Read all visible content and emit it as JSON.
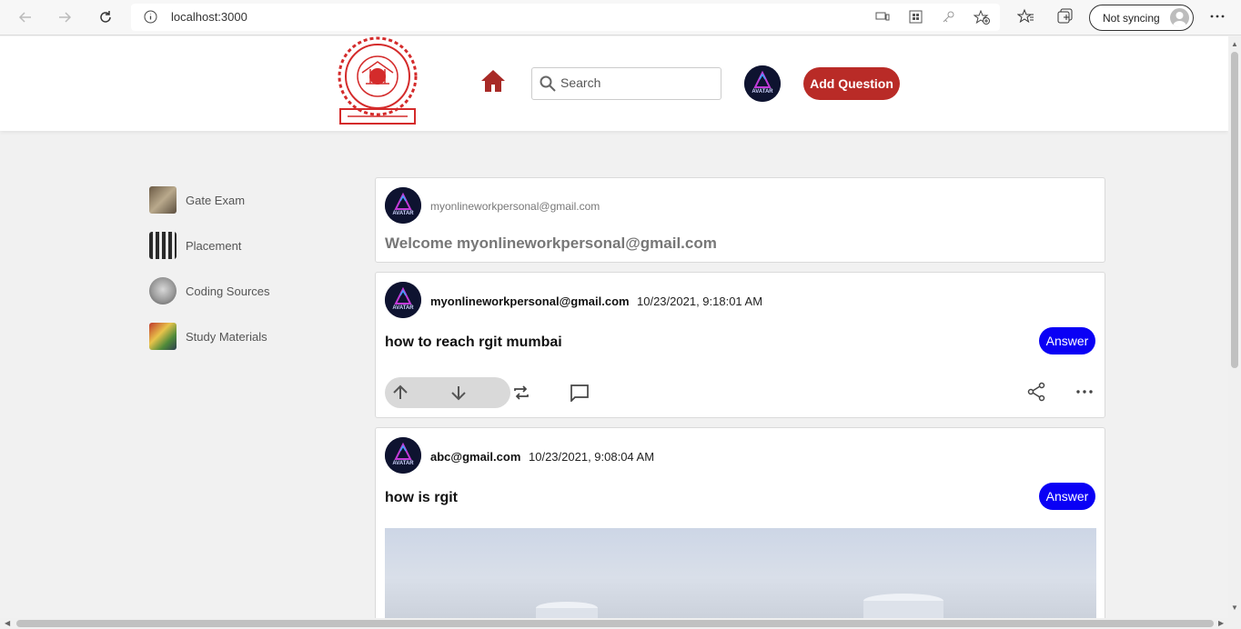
{
  "browser": {
    "url": "localhost:3000",
    "sync_label": "Not syncing"
  },
  "header": {
    "logo_alt": "RGIT logo",
    "search_placeholder": "Search",
    "add_question_label": "Add Question"
  },
  "avatar_text": "AVATAR",
  "sidebar": {
    "items": [
      {
        "label": "Gate Exam"
      },
      {
        "label": "Placement"
      },
      {
        "label": "Coding Sources"
      },
      {
        "label": "Study Materials"
      }
    ]
  },
  "welcome": {
    "email": "myonlineworkpersonal@gmail.com",
    "title": "Welcome myonlineworkpersonal@gmail.com"
  },
  "posts": [
    {
      "user": "myonlineworkpersonal@gmail.com",
      "time": "10/23/2021, 9:18:01 AM",
      "question": "how to reach rgit mumbai",
      "answer_label": "Answer"
    },
    {
      "user": "abc@gmail.com",
      "time": "10/23/2021, 9:08:04 AM",
      "question": "how is rgit",
      "answer_label": "Answer"
    }
  ],
  "colors": {
    "brand_red": "#b92b27",
    "answer_blue": "#0a00f5"
  }
}
